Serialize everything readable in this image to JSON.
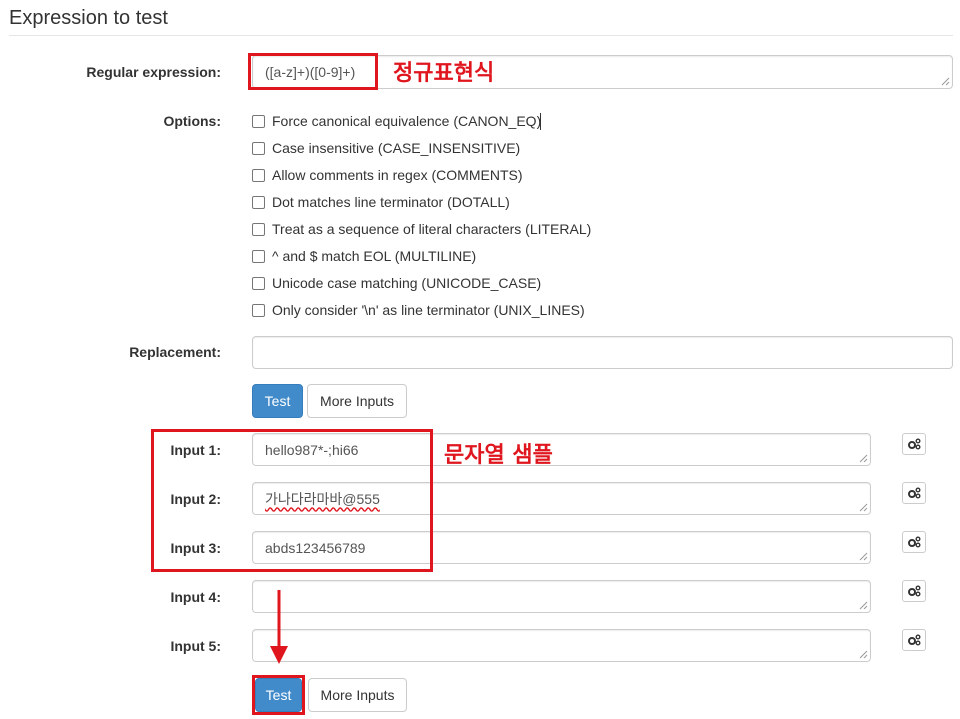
{
  "section_title": "Expression to test",
  "regex": {
    "label": "Regular expression:",
    "value": "([a-z]+)([0-9]+)",
    "annotation": "정규표현식"
  },
  "options": {
    "label": "Options:",
    "items": [
      {
        "label": "Force canonical equivalence (CANON_EQ)",
        "checked": false
      },
      {
        "label": "Case insensitive (CASE_INSENSITIVE)",
        "checked": false
      },
      {
        "label": "Allow comments in regex (COMMENTS)",
        "checked": false
      },
      {
        "label": "Dot matches line terminator (DOTALL)",
        "checked": false
      },
      {
        "label": "Treat as a sequence of literal characters (LITERAL)",
        "checked": false
      },
      {
        "label": "^ and $ match EOL (MULTILINE)",
        "checked": false
      },
      {
        "label": "Unicode case matching (UNICODE_CASE)",
        "checked": false
      },
      {
        "label": "Only consider '\\n' as line terminator (UNIX_LINES)",
        "checked": false
      }
    ]
  },
  "replacement": {
    "label": "Replacement:",
    "value": ""
  },
  "buttons": {
    "test": "Test",
    "more_inputs": "More Inputs"
  },
  "inputs": [
    {
      "label": "Input 1:",
      "value": "hello987*-;hi66"
    },
    {
      "label": "Input 2:",
      "value": "가나다라마바@555"
    },
    {
      "label": "Input 3:",
      "value": "abds123456789"
    },
    {
      "label": "Input 4:",
      "value": ""
    },
    {
      "label": "Input 5:",
      "value": ""
    }
  ],
  "inputs_annotation": "문자열 샘플",
  "colors": {
    "primary": "#428bca",
    "annotation_red": "#e0161f",
    "border": "#cccccc"
  },
  "icons": {
    "input_options": "gears-icon",
    "pointer": "arrow-down-icon"
  }
}
